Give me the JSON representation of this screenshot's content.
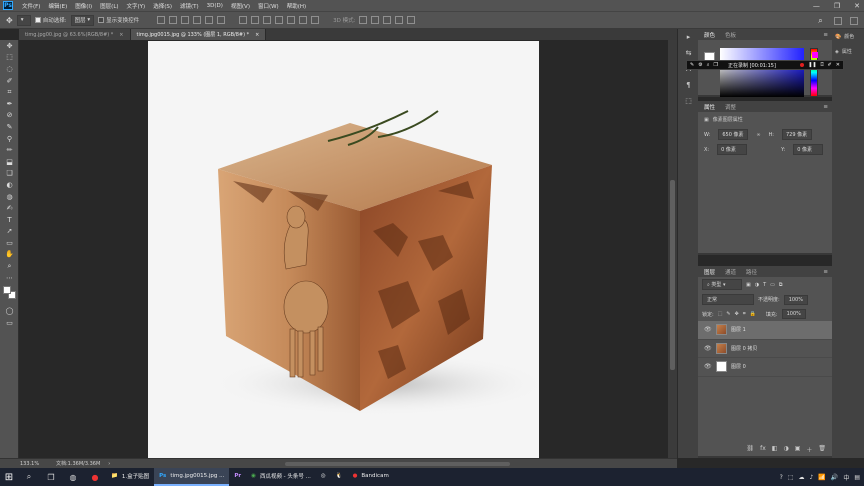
{
  "menubar": {
    "logo": "Ps",
    "items": [
      "文件(F)",
      "编辑(E)",
      "图像(I)",
      "图层(L)",
      "文字(Y)",
      "选择(S)",
      "滤镜(T)",
      "3D(D)",
      "视图(V)",
      "窗口(W)",
      "帮助(H)"
    ],
    "min_icon": "—",
    "max_icon": "❐",
    "close_icon": "✕"
  },
  "options": {
    "auto_select_label": "自动选择:",
    "auto_select_value": "图层",
    "transform_label": "显示变换控件",
    "mode_label": "3D 模式:"
  },
  "tabs": [
    {
      "label": "timg.jpg00.jpg @ 63.6%(RGB/8#) *",
      "close": "×"
    },
    {
      "label": "timg.jpg0015.jpg @ 133% (图层 1, RGB/8#) *",
      "close": "×"
    }
  ],
  "tools": [
    "✥",
    "⬚",
    "◌",
    "✐",
    "⌗",
    "✒",
    "⊘",
    "✎",
    "⚲",
    "✏",
    "⬓",
    "❑",
    "◐",
    "◍",
    "✍",
    "T",
    "➚",
    "▭",
    "✋",
    "⌕",
    "⋯"
  ],
  "status": {
    "zoom": "133.1%",
    "doc": "文档:1.36M/3.36M",
    "arrow": "›"
  },
  "color_panel": {
    "tabs": [
      "颜色",
      "色板"
    ],
    "menu": "≡"
  },
  "recorder": {
    "label": "正在录制 [00:01:15]"
  },
  "properties": {
    "tabs": [
      "属性",
      "调整"
    ],
    "menu": "≡",
    "subtitle": "像素图层属性",
    "w_label": "W:",
    "w_value": "650 像素",
    "link_icon": "∞",
    "h_label": "H:",
    "h_value": "729 像素",
    "x_label": "X:",
    "x_value": "0 像素",
    "y_label": "Y:",
    "y_value": "0 像素"
  },
  "layers_panel": {
    "tabs": [
      "图层",
      "通道",
      "路径"
    ],
    "menu": "≡",
    "filter_label": "类型",
    "blend_mode": "正常",
    "opacity_label": "不透明度:",
    "opacity_value": "100%",
    "lock_label": "锁定:",
    "fill_label": "填充:",
    "fill_value": "100%",
    "layers": [
      {
        "name": "图层 1",
        "selected": true,
        "thumb": "cube"
      },
      {
        "name": "图层 0 拷贝",
        "selected": false,
        "thumb": "cube"
      },
      {
        "name": "图层 0",
        "selected": false,
        "thumb": "white"
      }
    ],
    "footer_icons": [
      "⛓",
      "fx",
      "◧",
      "◑",
      "▣",
      "＋",
      "🗑"
    ]
  },
  "side_strip": [
    "▸",
    "⇆",
    "A",
    "¶",
    "⬚"
  ],
  "far_strip": [
    {
      "icon": "🎨",
      "label": "颜色"
    },
    {
      "icon": "◈",
      "label": "属性"
    }
  ],
  "taskbar": {
    "apps": [
      {
        "icon": "📁",
        "label": "1.盒子贴图"
      },
      {
        "icon": "Ps",
        "label": "timg.jpg0015.jpg ..."
      },
      {
        "icon": "Pr",
        "label": ""
      },
      {
        "icon": "◉",
        "label": "西瓜视频 - 头条号 ..."
      },
      {
        "icon": "◎",
        "label": ""
      },
      {
        "icon": "🐧",
        "label": ""
      },
      {
        "icon": "●",
        "label": "Bandicam"
      }
    ],
    "tray": [
      "?",
      "⬚",
      "☁",
      "♪",
      "📶",
      "🔊",
      "中"
    ]
  }
}
